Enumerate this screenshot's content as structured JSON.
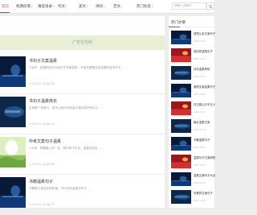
{
  "nav": {
    "items": [
      {
        "label": "首页",
        "caret": false
      },
      {
        "label": "经典段落",
        "caret": true
      },
      {
        "label": "唯美语录",
        "caret": true
      },
      {
        "label": "作文",
        "caret": true
      },
      {
        "label": "美文",
        "caret": true
      },
      {
        "label": "诗词",
        "caret": true
      },
      {
        "label": "范文",
        "caret": true
      },
      {
        "label": "热门标签",
        "caret": true
      }
    ],
    "search_placeholder": "请输入关键字",
    "accent_color": "#e03a30"
  },
  "ad": {
    "text": "广告位招租"
  },
  "posts": [
    {
      "title": "书句子文案温柔",
      "excerpt": "1.读书，如果你还在为找句子文案发愁，不如来看看这些温柔的读书句子……",
      "date": "2023-12-16",
      "views": "264",
      "thumb": "night-blue"
    },
    {
      "title": "书句子温柔简长",
      "excerpt": "生命是一场旅行，读书让我们在旅途中遇见更好的自己……",
      "date": "2023-12-16",
      "views": "412",
      "thumb": "dark-blue"
    },
    {
      "title": "中考文案句子温柔",
      "excerpt": "1.中考，青春路上的一站，愿你笔下生花，温柔而坚定……",
      "date": "2023-12-16",
      "views": "359",
      "thumb": "green-sunny"
    },
    {
      "title": "书籍温柔句子",
      "excerpt": "书籍是人类进步的阶梯，书中自有温柔的句子……",
      "date": "2023-12-16",
      "views": "277",
      "thumb": "night-blue"
    }
  ],
  "sidebar": {
    "title": "热门文章",
    "items": [
      {
        "title": "感恩父亲文案句子",
        "date": "2023-12-16",
        "thumb": "night-blue"
      },
      {
        "title": "感动的温柔句子",
        "date": "2023-12-16",
        "thumb": "red"
      },
      {
        "title": "诗句温柔简短",
        "date": "2023-12-16",
        "thumb": "dark-blue"
      },
      {
        "title": "美丽文案温柔句子",
        "date": "2023-12-16",
        "thumb": "night-blue"
      },
      {
        "title": "在日暮山中不见人",
        "date": "2023-12-16",
        "thumb": "red"
      },
      {
        "title": "最近温柔文案",
        "date": "2023-12-16",
        "thumb": "dark-blue"
      },
      {
        "title": "书籍温柔句子",
        "date": "2023-12-16",
        "thumb": "night-blue"
      },
      {
        "title": "温柔句子文案简短",
        "date": "2023-12-16",
        "thumb": "red"
      },
      {
        "title": "温柔文案句子大全",
        "date": "2023-12-16",
        "thumb": "night-blue"
      },
      {
        "title": "好看的文案句子",
        "date": "2023-12-16",
        "thumb": "dark-blue"
      }
    ]
  }
}
